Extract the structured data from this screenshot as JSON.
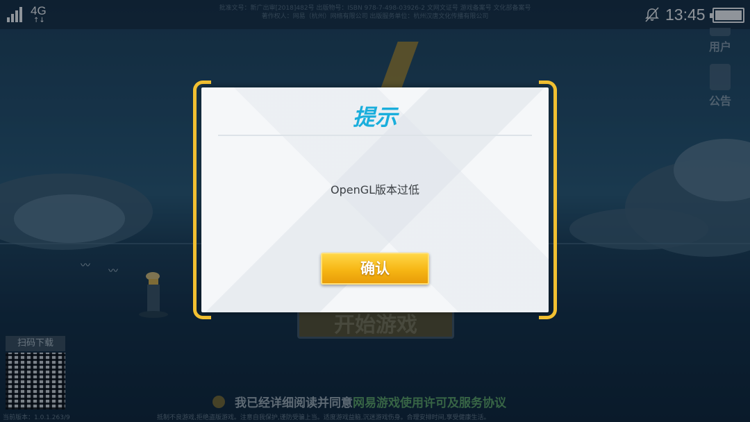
{
  "status_bar": {
    "network": "4G",
    "network_arrows": "↑↓",
    "signal_icon": "signal-bars-icon",
    "notification_icon": "bell-muted-icon",
    "time": "13:45",
    "battery_icon": "battery-full-icon",
    "legal_line_1": "批准文号：新广出审[2018]482号 出版物号：ISBN 978-7-498-03926-2 文网文证号 游戏备案号 文化部备案号",
    "legal_line_2": "著作权人：网易（杭州）网络有限公司 出版服务单位：杭州汉唐文化传播有限公司"
  },
  "side_menu": {
    "user_label": "用户",
    "notice_label": "公告"
  },
  "background": {
    "start_game_label": "开始游戏",
    "qr_label": "扫码下载",
    "agreement_prefix": "我已经详细阅读并同意",
    "agreement_link": "网易游戏使用许可及服务协议",
    "version_text": "当前版本：1.0.1.263/9",
    "health_notice": "抵制不良游戏,拒绝盗版游戏。注意自我保护,谨防受骗上当。适度游戏益脑,沉迷游戏伤身。合理安排时间,享受健康生活。"
  },
  "dialog": {
    "title": "提示",
    "message": "OpenGL版本过低",
    "confirm_label": "确认"
  },
  "colors": {
    "accent_yellow": "#f4c232",
    "title_blue": "#1aaedc",
    "agreement_green": "#5fa864"
  }
}
